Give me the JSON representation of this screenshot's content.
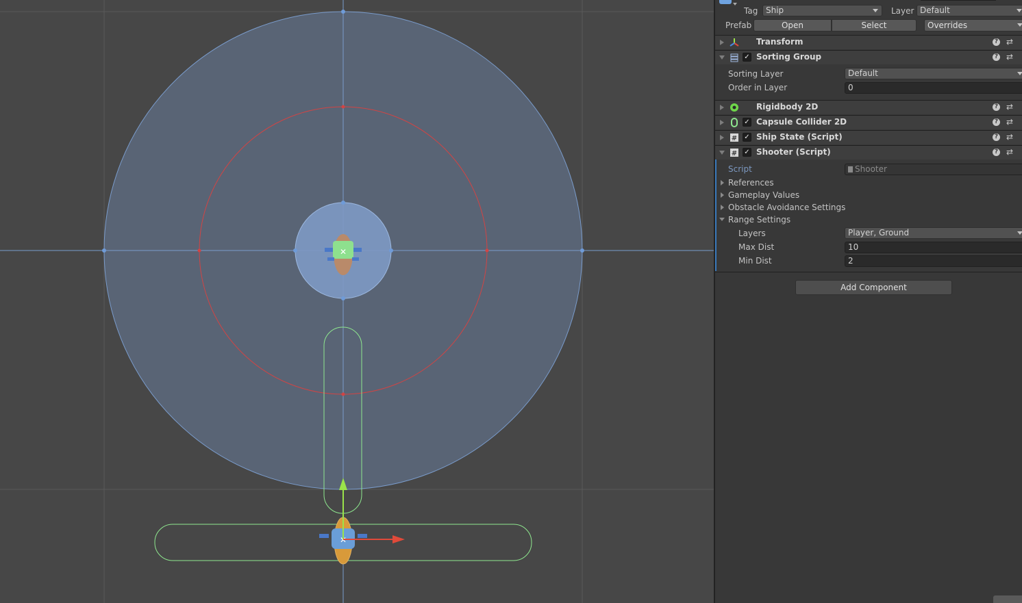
{
  "inspector": {
    "tag_label": "Tag",
    "tag_value": "Ship",
    "layer_label": "Layer",
    "layer_value": "Default",
    "prefab_label": "Prefab",
    "prefab_open": "Open",
    "prefab_select": "Select",
    "prefab_overrides": "Overrides",
    "components": [
      {
        "title": "Transform",
        "icon": "transform-icon"
      },
      {
        "title": "Sorting Group",
        "icon": "sorting-group-icon",
        "enabled": true
      },
      {
        "title": "Rigidbody 2D",
        "icon": "rigidbody-icon"
      },
      {
        "title": "Capsule Collider 2D",
        "icon": "capsule-collider-icon",
        "enabled": true
      },
      {
        "title": "Ship State (Script)",
        "icon": "script-icon",
        "enabled": true
      },
      {
        "title": "Shooter (Script)",
        "icon": "script-icon",
        "enabled": true
      }
    ],
    "sorting_group": {
      "sorting_layer_label": "Sorting Layer",
      "sorting_layer_value": "Default",
      "order_label": "Order in Layer",
      "order_value": "0"
    },
    "shooter": {
      "script_label": "Script",
      "script_value": "Shooter",
      "sections": [
        "References",
        "Gameplay Values",
        "Obstacle Avoidance Settings",
        "Range Settings"
      ],
      "layers_label": "Layers",
      "layers_value": "Player, Ground",
      "max_dist_label": "Max Dist",
      "max_dist_value": "10",
      "min_dist_label": "Min Dist",
      "min_dist_value": "2"
    },
    "add_component": "Add Component",
    "help_glyph": "?",
    "preset_glyph": "⇄",
    "check_glyph": "✓"
  },
  "colors": {
    "scene_bg": "#474747",
    "inspector_bg": "#383838",
    "range_outer": "#7a9ccc",
    "range_max": "#d24444",
    "collider_green": "#8fe88f",
    "accent_blue": "#3a79bb"
  }
}
